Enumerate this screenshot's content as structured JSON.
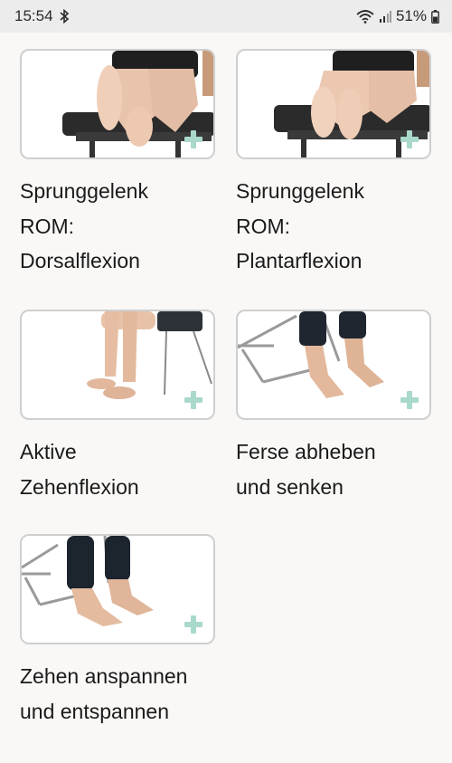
{
  "status_bar": {
    "time": "15:54",
    "battery": "51%",
    "icons": [
      "bluetooth-icon",
      "wifi-icon",
      "signal-icon",
      "battery-icon"
    ]
  },
  "exercises": [
    {
      "title_lines": [
        "Sprunggelenk",
        "ROM:",
        "Dorsalflexion"
      ]
    },
    {
      "title_lines": [
        "Sprunggelenk",
        "ROM:",
        "Plantarflexion"
      ]
    },
    {
      "title_lines": [
        "Aktive",
        "Zehenflexion"
      ]
    },
    {
      "title_lines": [
        "Ferse abheben",
        "und senken"
      ]
    },
    {
      "title_lines": [
        "Zehen anspannen",
        "und entspannen"
      ]
    }
  ],
  "colors": {
    "background": "#faf8f6",
    "status_bar": "#ececec",
    "card_border": "#cfcfcf",
    "plus_accent": "#a9d8cc"
  }
}
